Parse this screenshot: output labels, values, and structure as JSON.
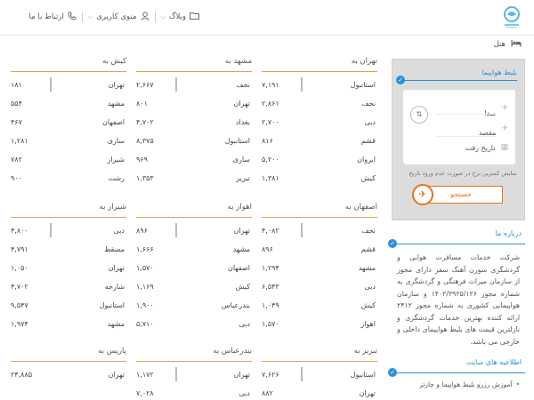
{
  "header": {
    "nav": [
      {
        "label": "وبلاگ",
        "icon": "folder-icon"
      },
      {
        "label": "منوی کاربری",
        "icon": "user-icon"
      },
      {
        "label": "ارتباط با ما",
        "icon": "phone-icon"
      }
    ]
  },
  "breadcrumb": {
    "label": "هتل",
    "icon": "hotel-bed-icon"
  },
  "flight_search": {
    "title": "بلیط هواپیما",
    "origin_placeholder": "مبدا",
    "destination_placeholder": "مقصد",
    "date_placeholder": "تاریخ رفت",
    "notice": "نمایش کمترین نرخ در صورت عدم ورود تاریخ",
    "search_label": "جستجو"
  },
  "about": {
    "title": "درباره ما",
    "text": "شرکت خدمات مسافرت هوایی و گردشگری سورن آهنگ سفر دارای مجوز از سازمان میراث فرهنگی و گردشگری به شماره مجوز ۱۴۰۲/۲۹۲۵/۱۲۶ و سازمان هواپیمایی کشوری به شماره مجوز ۲۴۱۲ ارائه کننده بهترین خدمات گردشگری و نازلترین قیمت های بلیط هواپیمای داخلی و خارجی می باشد."
  },
  "announcements": {
    "title": "اطلاعیه های سایت",
    "items": [
      "آموزش رزرو بلیط هواپیما و چارتر"
    ]
  },
  "routes": [
    {
      "title": "تهران به",
      "rows": [
        [
          "استانبول",
          "۷,۱۹۱"
        ],
        [
          "نجف",
          "۲,۸۶۱"
        ],
        [
          "دبی",
          "۲,۷۰۰"
        ],
        [
          "قشم",
          "۸۱۶"
        ],
        [
          "ایروان",
          "۵,۲۰۰"
        ],
        [
          "کیش",
          "۱,۳۸۱"
        ]
      ]
    },
    {
      "title": "مشهد به",
      "rows": [
        [
          "نجف",
          "۲,۶۶۷"
        ],
        [
          "تهران",
          "۸۰۱"
        ],
        [
          "بغداد",
          "۴,۷۰۲"
        ],
        [
          "استانبول",
          "۸,۳۷۵"
        ],
        [
          "ساری",
          "۹۶۹"
        ],
        [
          "تبریز",
          "۱,۳۵۳"
        ]
      ]
    },
    {
      "title": "کیش به",
      "rows": [
        [
          "تهران",
          "۱۸۱"
        ],
        [
          "مشهد",
          "۵۵۴"
        ],
        [
          "اصفهان",
          "۴۶۷"
        ],
        [
          "ساری",
          "۱,۲۸۱"
        ],
        [
          "شیراز",
          "۷۸۲"
        ],
        [
          "رشت",
          "۹۰۰"
        ]
      ]
    },
    {
      "title": "اصفهان به",
      "rows": [
        [
          "نجف",
          "۴,۰۸۲"
        ],
        [
          "قشم",
          "۸۹۶"
        ],
        [
          "مشهد",
          "۱,۲۹۴"
        ],
        [
          "دبی",
          "۶,۵۴۳"
        ],
        [
          "کیش",
          "۱,۰۴۹"
        ],
        [
          "اهواز",
          "۱,۵۷۰"
        ]
      ]
    },
    {
      "title": "اهواز به",
      "rows": [
        [
          "تهران",
          "۸۹۶"
        ],
        [
          "مشهد",
          "۱,۶۶۶"
        ],
        [
          "اصفهان",
          "۱,۵۷۰"
        ],
        [
          "کیش",
          "۱,۱۶۹"
        ],
        [
          "بندرعباس",
          "۱,۹۰۰"
        ],
        [
          "دبی",
          "۵,۷۱۰"
        ]
      ]
    },
    {
      "title": "شیراز به",
      "rows": [
        [
          "دبی",
          "۴,۸۰۰"
        ],
        [
          "مسقط",
          "۴,۷۹۱"
        ],
        [
          "تهران",
          "۱,۰۵۰"
        ],
        [
          "شارجه",
          "۴,۷۰۲"
        ],
        [
          "استانبول",
          "۹,۵۴۷"
        ],
        [
          "مشهد",
          "۱,۹۷۴"
        ]
      ]
    },
    {
      "title": "تبریز به",
      "rows": [
        [
          "استانبول",
          "۷,۶۲۶"
        ],
        [
          "تهران",
          "۸۸۲"
        ]
      ]
    },
    {
      "title": "بندرعباس به",
      "rows": [
        [
          "تهران",
          "۱,۱۷۲"
        ],
        [
          "دبی",
          "۷,۰۲۸"
        ]
      ]
    },
    {
      "title": "پاریس به",
      "rows": [
        [
          "تهران",
          "۲۴,۸۸۵"
        ]
      ]
    }
  ]
}
